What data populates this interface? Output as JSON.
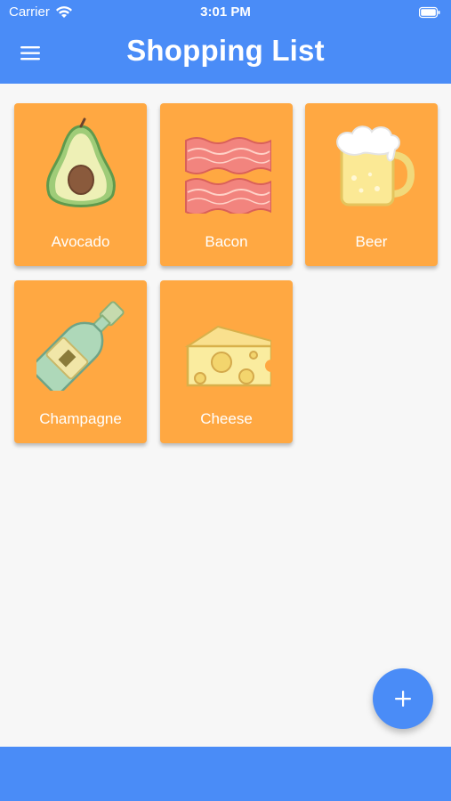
{
  "status_bar": {
    "carrier": "Carrier",
    "time": "3:01 PM",
    "wifi_icon": "wifi-icon",
    "battery_icon": "battery-icon"
  },
  "header": {
    "menu_icon": "hamburger-menu-icon",
    "title": "Shopping List"
  },
  "items": [
    {
      "label": "Avocado",
      "icon": "avocado-icon"
    },
    {
      "label": "Bacon",
      "icon": "bacon-icon"
    },
    {
      "label": "Beer",
      "icon": "beer-mug-icon"
    },
    {
      "label": "Champagne",
      "icon": "champagne-bottle-icon"
    },
    {
      "label": "Cheese",
      "icon": "cheese-icon"
    }
  ],
  "fab": {
    "icon": "plus-icon"
  },
  "colors": {
    "primary": "#4a8cf7",
    "card": "#ffa842",
    "background": "#f7f7f7"
  }
}
